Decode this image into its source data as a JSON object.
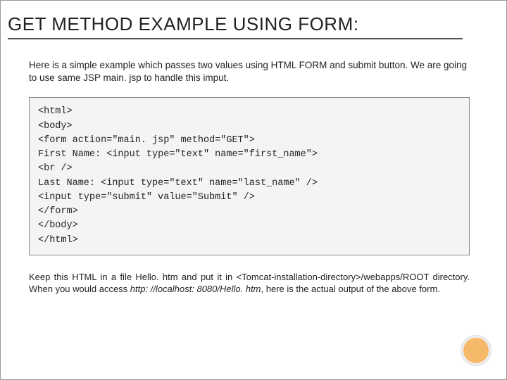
{
  "title": "GET METHOD EXAMPLE USING FORM:",
  "intro": "Here is a simple example which passes two values using HTML FORM and submit button. We are going to use same JSP main. jsp to handle this imput.",
  "code_lines": [
    "<html>",
    "<body>",
    "<form action=\"main. jsp\" method=\"GET\">",
    "First Name: <input type=\"text\" name=\"first_name\">",
    "<br />",
    "Last Name: <input type=\"text\" name=\"last_name\" />",
    "<input type=\"submit\" value=\"Submit\" />",
    "</form>",
    "</body>",
    "</html>"
  ],
  "footnote_pre": "Keep this HTML in a file Hello. htm and put it in <Tomcat-installation-directory>/webapps/ROOT directory. When you would access ",
  "footnote_url": "http: //localhost: 8080/Hello. htm",
  "footnote_post": ", here is the actual output of the above form."
}
